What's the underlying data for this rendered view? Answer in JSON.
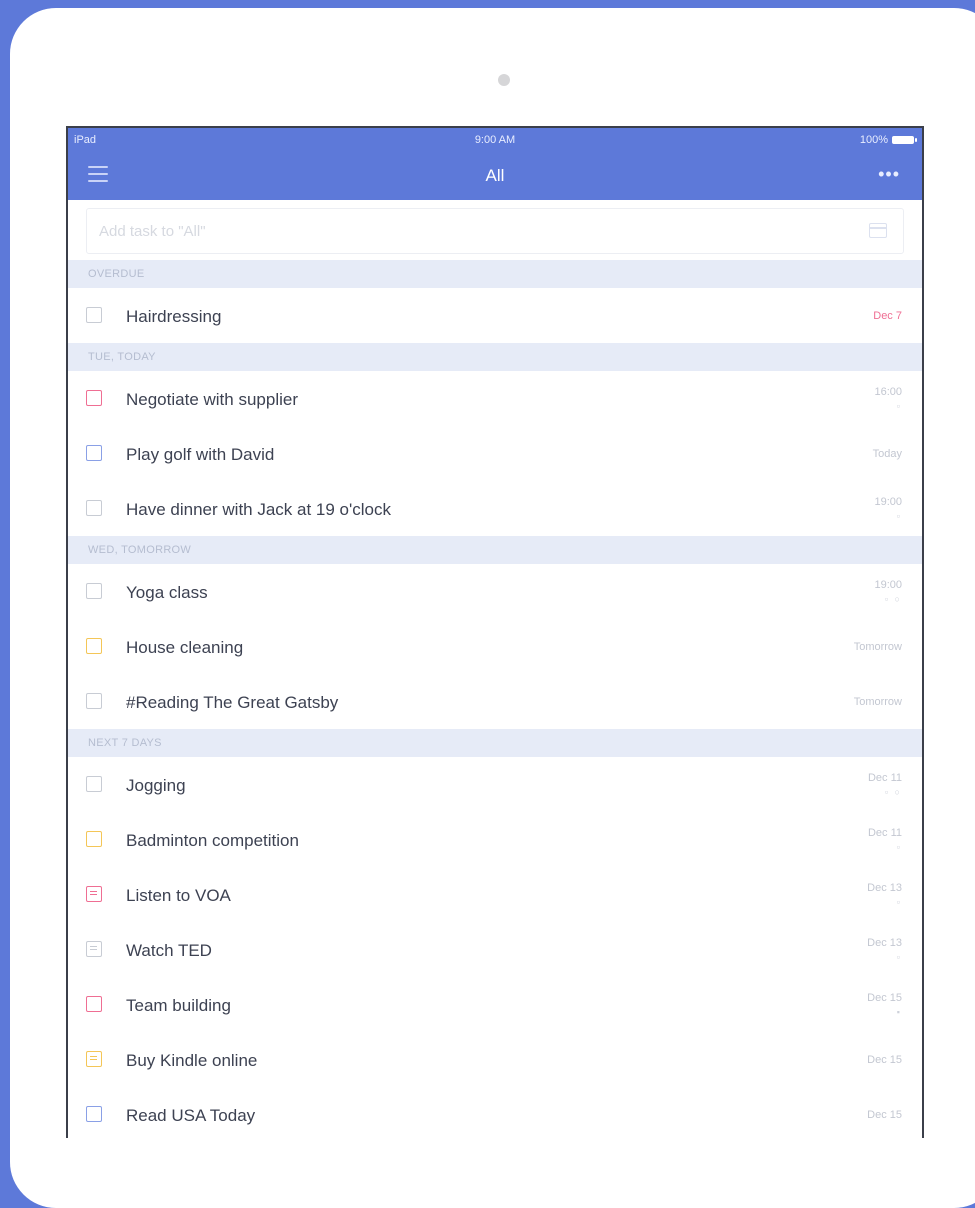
{
  "status_bar": {
    "carrier": "iPad",
    "time": "9:00 AM",
    "battery": "100%"
  },
  "nav": {
    "title": "All",
    "menu_icon": "hamburger-menu-icon",
    "more_icon": "more-horizontal-icon"
  },
  "add_task": {
    "placeholder": "Add task to \"All\"",
    "value": ""
  },
  "colors": {
    "accent": "#5d79d9",
    "overdue": "#ef6e93",
    "priority_red": "#ef6e93",
    "priority_blue": "#8aa0e6",
    "priority_yellow": "#f4c657"
  },
  "sections": [
    {
      "header": "OVERDUE",
      "tasks": [
        {
          "title": "Hairdressing",
          "meta": "Dec 7",
          "icons": "",
          "priority": "gray"
        }
      ]
    },
    {
      "header": "TUE, TODAY",
      "tasks": [
        {
          "title": "Negotiate with supplier",
          "meta": "16:00",
          "icons": "▫",
          "priority": "red"
        },
        {
          "title": "Play golf with David",
          "meta": "Today",
          "icons": "",
          "priority": "blue"
        },
        {
          "title": "Have dinner with Jack at 19 o'clock",
          "meta": "19:00",
          "icons": "▫",
          "priority": "gray"
        }
      ]
    },
    {
      "header": "WED, TOMORROW",
      "tasks": [
        {
          "title": "Yoga class",
          "meta": "19:00",
          "icons": "▫ ○",
          "priority": "gray"
        },
        {
          "title": "House cleaning",
          "meta": "Tomorrow",
          "icons": "",
          "priority": "yellow"
        },
        {
          "title": " #Reading The Great Gatsby",
          "meta": "Tomorrow",
          "icons": "",
          "priority": "gray"
        }
      ]
    },
    {
      "header": "NEXT 7 DAYS",
      "tasks": [
        {
          "title": "Jogging",
          "meta": "Dec 11",
          "icons": "▫ ○",
          "priority": "gray"
        },
        {
          "title": "Badminton competition",
          "meta": "Dec 11",
          "icons": "▫",
          "priority": "yellow"
        },
        {
          "title": "Listen to VOA",
          "meta": "Dec 13",
          "icons": "▫",
          "priority": "red-note"
        },
        {
          "title": "Watch TED",
          "meta": "Dec 13",
          "icons": "▫",
          "priority": "gray-note"
        },
        {
          "title": "Team building",
          "meta": "Dec 15",
          "icons": "▪",
          "priority": "red"
        },
        {
          "title": "Buy Kindle online",
          "meta": "Dec 15",
          "icons": "",
          "priority": "yellow-note"
        },
        {
          "title": "Read USA Today",
          "meta": "Dec 15",
          "icons": "",
          "priority": "blue"
        }
      ]
    }
  ]
}
